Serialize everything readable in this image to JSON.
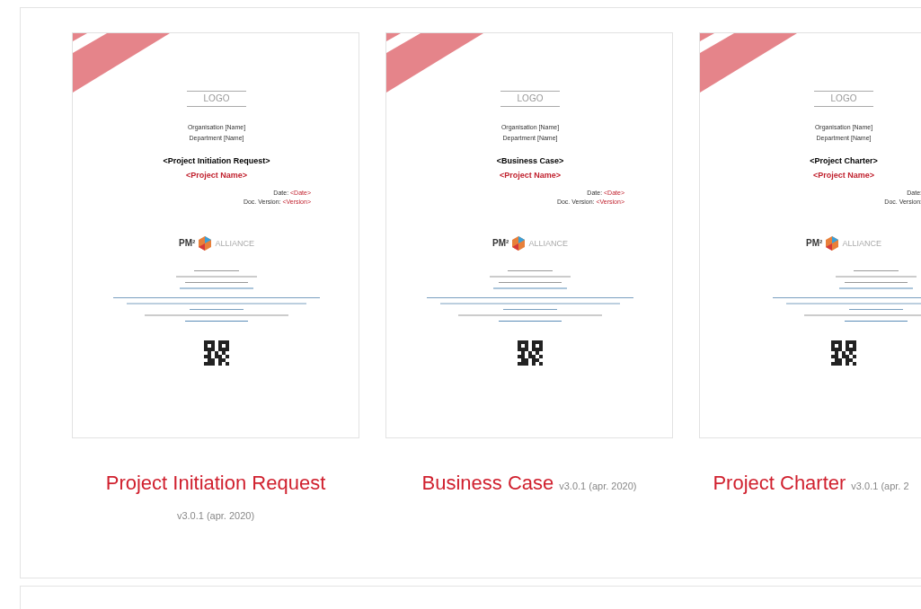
{
  "templates": [
    {
      "document": {
        "logo": "LOGO",
        "organisation": "Organisation [Name]",
        "department": "Department [Name]",
        "title": "<Project Initiation Request>",
        "project_name": "<Project Name>",
        "date_label": "Date:",
        "date_value": "<Date>",
        "version_label": "Doc. Version:",
        "version_value": "<Version>",
        "brand_mark": "PM²",
        "brand_name": "ALLIANCE"
      },
      "title": "Project Initiation Request",
      "version": "v3.0.1 (apr. 2020)"
    },
    {
      "document": {
        "logo": "LOGO",
        "organisation": "Organisation [Name]",
        "department": "Department [Name]",
        "title": "<Business Case>",
        "project_name": "<Project Name>",
        "date_label": "Date:",
        "date_value": "<Date>",
        "version_label": "Doc. Version:",
        "version_value": "<Version>",
        "brand_mark": "PM²",
        "brand_name": "ALLIANCE"
      },
      "title": "Business Case",
      "version": "v3.0.1 (apr. 2020)"
    },
    {
      "document": {
        "logo": "LOGO",
        "organisation": "Organisation [Name]",
        "department": "Department [Name]",
        "title": "<Project Charter>",
        "project_name": "<Project Name>",
        "date_label": "Date:",
        "version_label": "Doc. Version:",
        "brand_mark": "PM²",
        "brand_name": "ALLIANCE"
      },
      "title": "Project Charter",
      "version": "v3.0.1 (apr. 2"
    }
  ]
}
